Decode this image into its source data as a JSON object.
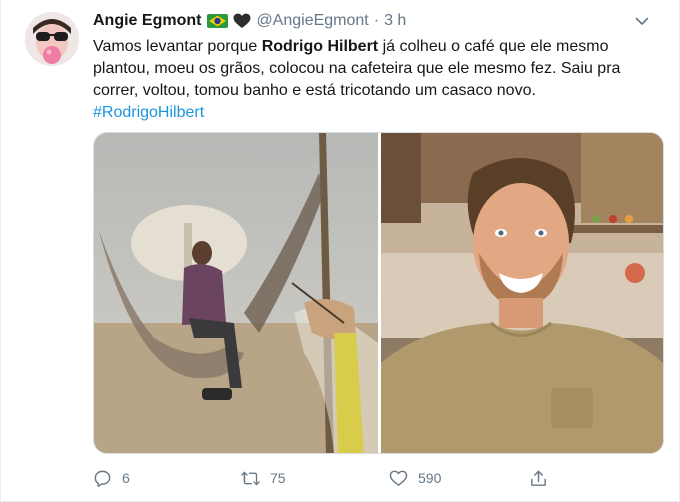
{
  "tweet": {
    "author": {
      "display_name": "Angie Egmont",
      "handle": "@AngieEgmont",
      "badges": [
        "brazil-flag-icon",
        "black-heart-icon"
      ]
    },
    "separator": "·",
    "time": "3 h",
    "text": {
      "part1": "Vamos levantar porque ",
      "bold": "Rodrigo Hilbert",
      "part2": " já colheu o café que ele mesmo plantou, moeu os grãos, colocou na cafeteira que ele mesmo fez. Saiu pra correr, voltou, tomou banho e está tricotando um casaco novo.",
      "hashtag": "#RodrigoHilbert"
    },
    "counts": {
      "replies": "6",
      "retweets": "75",
      "likes": "590"
    }
  },
  "colors": {
    "text": "#14171a",
    "secondary": "#657786",
    "link": "#1b95e0",
    "border": "#e6ecf0"
  }
}
